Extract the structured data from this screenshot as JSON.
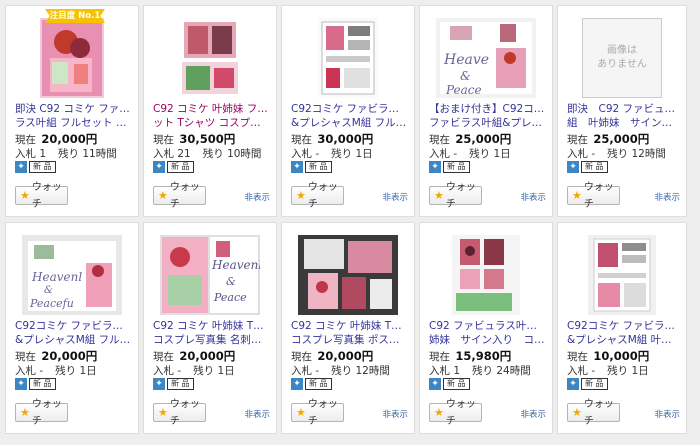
{
  "items": [
    {
      "rank_label": "注目度 No.1",
      "title_lines": [
        "即決 C92 コミケ ファビュ",
        "ラス叶組 フルセット 叶姉…"
      ],
      "price_label": "現在",
      "price": "20,000円",
      "bids_label": "入札",
      "bids": "1",
      "remain_label": "残り",
      "remain": "11時間",
      "condition": "新 品",
      "watch_label": "ウォッチ",
      "hide_label": "",
      "visited": false,
      "has_image": true
    },
    {
      "title_lines": [
        "C92 コミケ 叶姉妹 フルセ",
        "ット Tシャツ コスプレ写真…"
      ],
      "price_label": "現在",
      "price": "30,500円",
      "bids_label": "入札",
      "bids": "21",
      "remain_label": "残り",
      "remain": "10時間",
      "condition": "新 品",
      "watch_label": "ウォッチ",
      "hide_label": "非表示",
      "visited": true,
      "has_image": true
    },
    {
      "title_lines": [
        "C92コミケ ファビラス叶組",
        "&プレシャスM組 フルセッ…"
      ],
      "price_label": "現在",
      "price": "30,000円",
      "bids_label": "入札",
      "bids": "-",
      "remain_label": "残り",
      "remain": "1日",
      "condition": "新 品",
      "watch_label": "ウォッチ",
      "hide_label": "非表示",
      "visited": false,
      "has_image": true
    },
    {
      "title_lines": [
        "【おまけ付き】C92コミケ",
        "ファビラス叶組&プレシャ…"
      ],
      "price_label": "現在",
      "price": "25,000円",
      "bids_label": "入札",
      "bids": "-",
      "remain_label": "残り",
      "remain": "1日",
      "condition": "新 品",
      "watch_label": "ウォッチ",
      "hide_label": "非表示",
      "visited": false,
      "has_image": true
    },
    {
      "title_lines": [
        "即決　C92 ファビュラス叶",
        "組　叶姉妹　サイン入り こ…"
      ],
      "price_label": "現在",
      "price": "25,000円",
      "bids_label": "入札",
      "bids": "-",
      "remain_label": "残り",
      "remain": "12時間",
      "condition": "新 品",
      "watch_label": "ウォッチ",
      "hide_label": "非表示",
      "visited": false,
      "has_image": false,
      "noimage_lines": [
        "画像は",
        "ありません"
      ]
    },
    {
      "title_lines": [
        "C92コミケ ファビラス叶組",
        "&プレシャスM組 フルセッ…"
      ],
      "price_label": "現在",
      "price": "20,000円",
      "bids_label": "入札",
      "bids": "-",
      "remain_label": "残り",
      "remain": "1日",
      "condition": "新 品",
      "watch_label": "ウォッチ",
      "hide_label": "",
      "visited": false,
      "has_image": true
    },
    {
      "title_lines": [
        "C92 コミケ 叶姉妹 Tシャツ",
        "コスプレ写真集 名刺付き …"
      ],
      "price_label": "現在",
      "price": "20,000円",
      "bids_label": "入札",
      "bids": "-",
      "remain_label": "残り",
      "remain": "1日",
      "condition": "新 品",
      "watch_label": "ウォッチ",
      "hide_label": "非表示",
      "visited": false,
      "has_image": true
    },
    {
      "title_lines": [
        "C92 コミケ 叶姉妹 Tシャツ",
        "コスプレ写真集 ポストカ…"
      ],
      "price_label": "現在",
      "price": "20,000円",
      "bids_label": "入札",
      "bids": "-",
      "remain_label": "残り",
      "remain": "12時間",
      "condition": "新 品",
      "watch_label": "ウォッチ",
      "hide_label": "非表示",
      "visited": false,
      "has_image": true
    },
    {
      "title_lines": [
        "C92 ファビュラス叶組　叶",
        "姉妹　サイン入り　コス…"
      ],
      "price_label": "現在",
      "price": "15,980円",
      "bids_label": "入札",
      "bids": "1",
      "remain_label": "残り",
      "remain": "24時間",
      "condition": "新 品",
      "watch_label": "ウォッチ",
      "hide_label": "非表示",
      "visited": false,
      "has_image": true
    },
    {
      "title_lines": [
        "C92コミケ ファビラス叶組",
        "&プレシャスM組 叶姉妹 こ…"
      ],
      "price_label": "現在",
      "price": "10,000円",
      "bids_label": "入札",
      "bids": "-",
      "remain_label": "残り",
      "remain": "1日",
      "condition": "新 品",
      "watch_label": "ウォッチ",
      "hide_label": "非表示",
      "visited": false,
      "has_image": true
    }
  ],
  "icons": {
    "watch": "star-icon",
    "condition": "new-item-icon"
  },
  "colors": {
    "title_link": "#333399",
    "title_visited": "#990066",
    "rank_badge": "#f6c200",
    "star": "#f0a800"
  }
}
